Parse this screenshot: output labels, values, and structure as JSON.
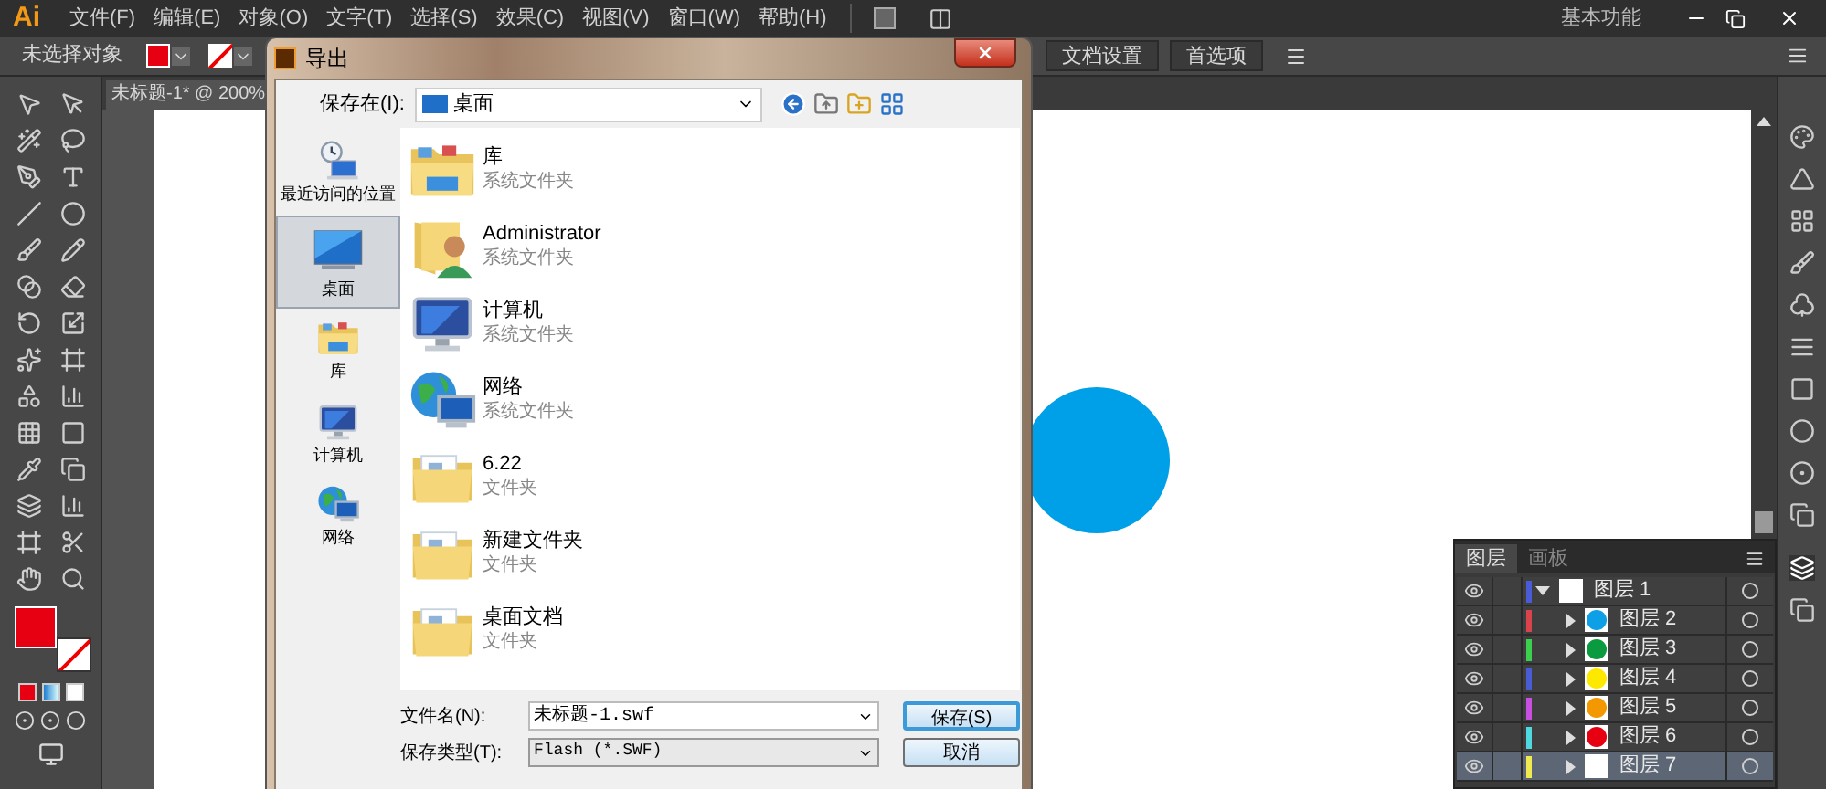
{
  "app": {
    "logo": "Ai",
    "menus": [
      "文件(F)",
      "编辑(E)",
      "对象(O)",
      "文字(T)",
      "选择(S)",
      "效果(C)",
      "视图(V)",
      "窗口(W)",
      "帮助(H)"
    ],
    "workspace": "基本功能"
  },
  "control_bar": {
    "selection": "未选择对象",
    "fill": {
      "color": "#e60012"
    },
    "buttons": [
      "文档设置",
      "首选项"
    ]
  },
  "document_tab": {
    "title": "未标题-1* @ 200%"
  },
  "canvas": {
    "shape": {
      "kind": "circle",
      "color": "#00a0e9"
    }
  },
  "toolbar": {
    "fill": {
      "color": "#e60012"
    }
  },
  "dialog": {
    "title": "导出",
    "save_in_label": "保存在(I):",
    "save_in_value": "桌面",
    "places": [
      {
        "label": "最近访问的位置",
        "kind": "recent",
        "selected": false
      },
      {
        "label": "桌面",
        "kind": "desktop",
        "selected": true
      },
      {
        "label": "库",
        "kind": "library",
        "selected": false
      },
      {
        "label": "计算机",
        "kind": "computer",
        "selected": false
      },
      {
        "label": "网络",
        "kind": "network",
        "selected": false
      }
    ],
    "files": [
      {
        "name": "库",
        "type": "系统文件夹",
        "kind": "library"
      },
      {
        "name": "Administrator",
        "type": "系统文件夹",
        "kind": "user"
      },
      {
        "name": "计算机",
        "type": "系统文件夹",
        "kind": "computer"
      },
      {
        "name": "网络",
        "type": "系统文件夹",
        "kind": "network"
      },
      {
        "name": "6.22",
        "type": "文件夹",
        "kind": "folder"
      },
      {
        "name": "新建文件夹",
        "type": "文件夹",
        "kind": "folder"
      },
      {
        "name": "桌面文档",
        "type": "文件夹",
        "kind": "folder"
      }
    ],
    "filename_label": "文件名(N):",
    "filename": "未标题-1.swf",
    "filetype_label": "保存类型(T):",
    "filetype": "Flash (*.SWF)",
    "buttons": [
      "保存(S)",
      "取消"
    ]
  },
  "layers_panel": {
    "tabs": [
      {
        "label": "图层",
        "selected": true
      },
      {
        "label": "画板",
        "selected": false
      }
    ],
    "layers": [
      {
        "name": "图层 1",
        "color": "#4a5bd6",
        "expanded": true,
        "selected": false,
        "children": [
          {
            "name": "图层 2",
            "color": "#d9434b",
            "expanded": false,
            "selected": false,
            "thumbnail": {
              "color": "#0ea0e6"
            }
          },
          {
            "name": "图层 3",
            "color": "#3ccf4e",
            "expanded": false,
            "selected": false,
            "thumbnail": {
              "color": "#0a9a40"
            }
          },
          {
            "name": "图层 4",
            "color": "#4a5bd6",
            "expanded": false,
            "selected": false,
            "thumbnail": {
              "color": "#fde800"
            }
          },
          {
            "name": "图层 5",
            "color": "#c84fe0",
            "expanded": false,
            "selected": false,
            "thumbnail": {
              "color": "#f39800"
            }
          },
          {
            "name": "图层 6",
            "color": "#4fd8e0",
            "expanded": false,
            "selected": false,
            "thumbnail": {
              "color": "#e60012"
            }
          },
          {
            "name": "图层 7",
            "color": "#f0ea50",
            "expanded": false,
            "selected": true
          }
        ]
      }
    ]
  }
}
